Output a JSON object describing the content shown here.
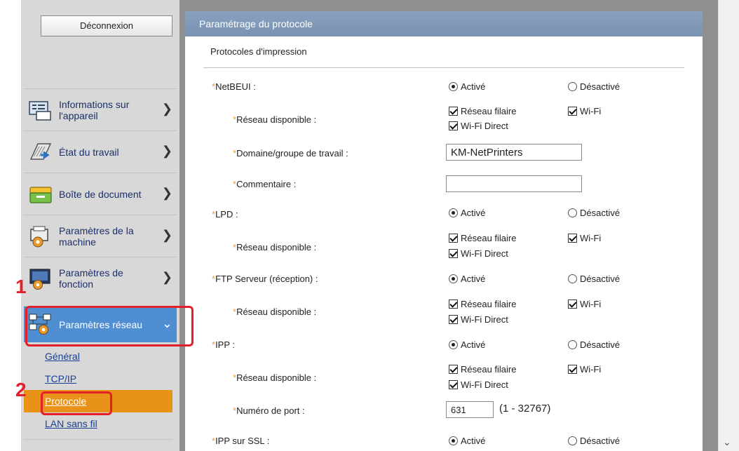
{
  "sidebar": {
    "logout_label": "Déconnexion",
    "items": [
      {
        "label": "Informations sur l'appareil",
        "icon": "device-info-icon"
      },
      {
        "label": "État du travail",
        "icon": "job-status-icon"
      },
      {
        "label": "Boîte de document",
        "icon": "document-box-icon"
      },
      {
        "label": "Paramètres de la machine",
        "icon": "machine-settings-icon"
      },
      {
        "label": "Paramètres de fonction",
        "icon": "function-settings-icon"
      },
      {
        "label": "Paramètres réseau",
        "icon": "network-settings-icon",
        "expanded": true,
        "selected": true
      }
    ],
    "subitems": [
      "Général",
      "TCP/IP",
      "Protocole",
      "LAN sans fil"
    ],
    "active_subitem": "Protocole",
    "callouts": [
      "1",
      "2"
    ]
  },
  "panel": {
    "title": "Paramétrage du protocole",
    "section": "Protocoles d'impression",
    "rows": [
      {
        "label": "NetBEUI :",
        "on": "Activé",
        "off": "Désactivé"
      },
      {
        "label": "Réseau disponible :",
        "opts": [
          "Réseau filaire",
          "Wi-Fi",
          "Wi-Fi Direct"
        ]
      },
      {
        "label": "Domaine/groupe de travail :",
        "value": "KM-NetPrinters"
      },
      {
        "label": "Commentaire :",
        "value": ""
      },
      {
        "label": "LPD :",
        "on": "Activé",
        "off": "Désactivé"
      },
      {
        "label": "Réseau disponible :",
        "opts": [
          "Réseau filaire",
          "Wi-Fi",
          "Wi-Fi Direct"
        ]
      },
      {
        "label": "FTP Serveur (réception) :",
        "on": "Activé",
        "off": "Désactivé"
      },
      {
        "label": "Réseau disponible :",
        "opts": [
          "Réseau filaire",
          "Wi-Fi",
          "Wi-Fi Direct"
        ]
      },
      {
        "label": "IPP :",
        "on": "Activé",
        "off": "Désactivé"
      },
      {
        "label": "Réseau disponible :",
        "opts": [
          "Réseau filaire",
          "Wi-Fi",
          "Wi-Fi Direct"
        ]
      },
      {
        "label": "Numéro de port :",
        "value": "631",
        "range": "(1 - 32767)"
      },
      {
        "label": "IPP sur SSL :",
        "on": "Activé",
        "off": "Désactivé"
      }
    ]
  },
  "colors": {
    "accent": "#4f8fd1",
    "highlight": "#e8921a",
    "callout": "#e3202a",
    "header": "#7a93b3"
  }
}
